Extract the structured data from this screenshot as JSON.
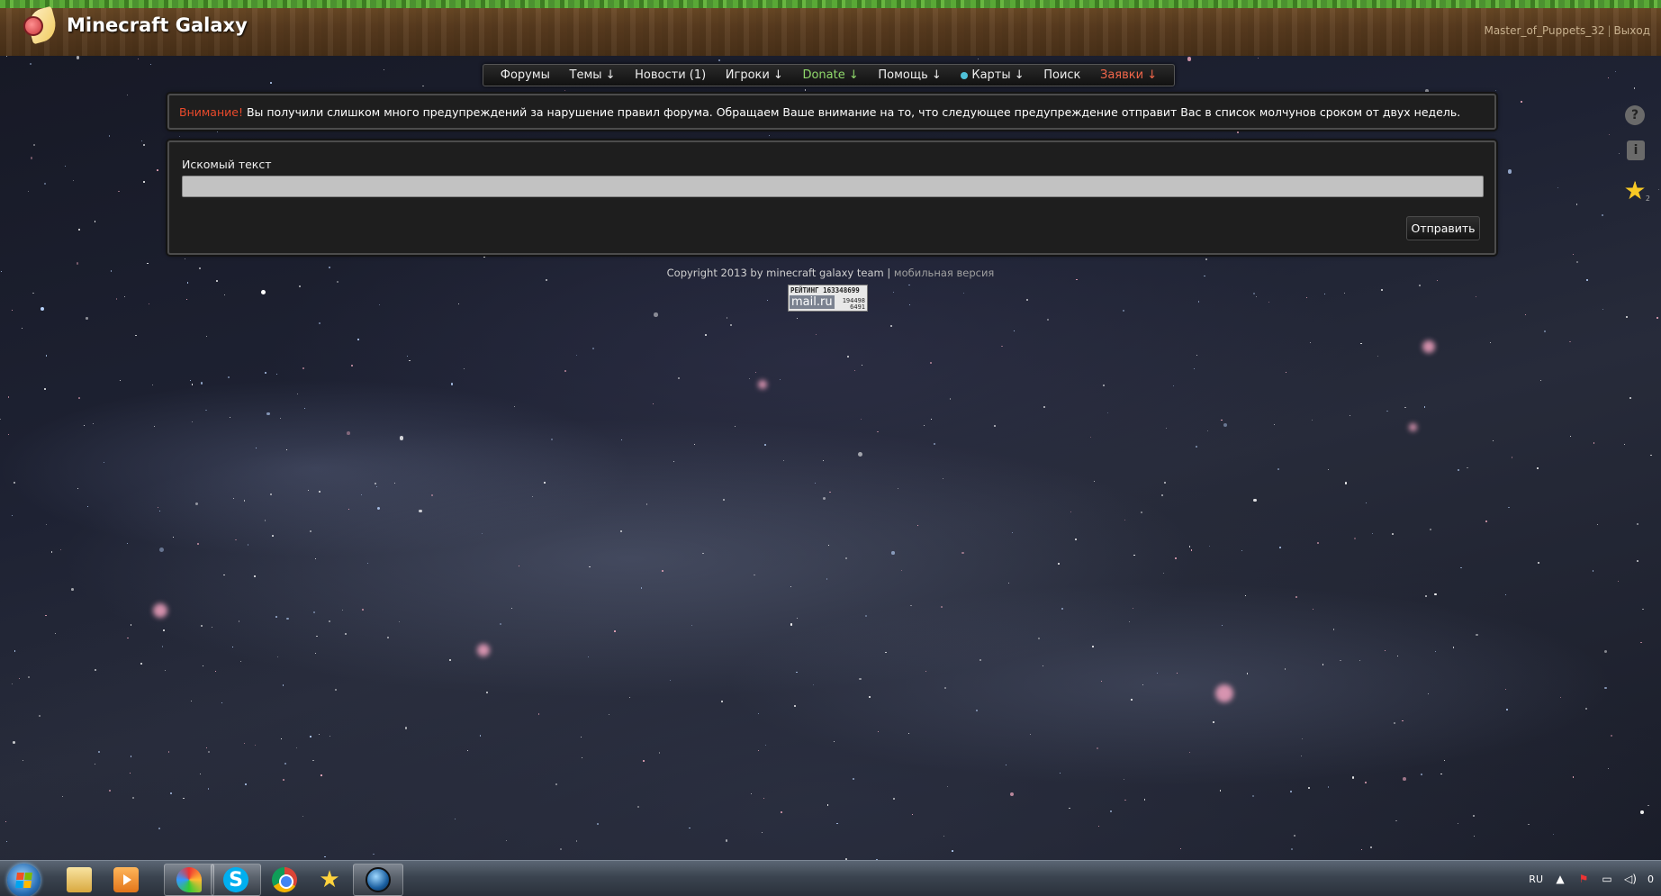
{
  "header": {
    "site_title": "Minecraft Galaxy",
    "username": "Master_of_Puppets_32",
    "separator": "|",
    "logout": "Выход"
  },
  "nav": {
    "items": [
      {
        "label": "Форумы",
        "type": "normal"
      },
      {
        "label": "Темы ↓",
        "type": "normal"
      },
      {
        "label": "Новости (1)",
        "type": "normal"
      },
      {
        "label": "Игроки ↓",
        "type": "normal"
      },
      {
        "label": "Donate ↓",
        "type": "donate"
      },
      {
        "label": "Помощь ↓",
        "type": "normal"
      },
      {
        "label": "Карты ↓",
        "type": "maps"
      },
      {
        "label": "Поиск",
        "type": "normal"
      },
      {
        "label": "Заявки ↓",
        "type": "zayavki"
      }
    ]
  },
  "alert": {
    "prefix": "Внимание!",
    "message": " Вы получили слишком много предупреждений за нарушение правил форума. Обращаем Ваше внимание на то, что следующее предупреждение отправит Вас в список молчунов сроком от двух недель."
  },
  "search": {
    "label": "Искомый текст",
    "value": "",
    "placeholder": "",
    "submit_label": "Отправить"
  },
  "footer": {
    "copyright": "Copyright 2013 by minecraft galaxy team",
    "separator": " | ",
    "mobile_link": "мобильная версия"
  },
  "counter": {
    "line1": "РЕЙТИНГ 163348699",
    "brand": "mail.ru",
    "line2": "194498",
    "line3": "6491"
  },
  "side_icons": {
    "help": "?",
    "info": "i",
    "favorites": "★",
    "favorites_count": "2"
  },
  "taskbar": {
    "apps": [
      {
        "icon": "folder-icon",
        "active": false
      },
      {
        "icon": "media-player-icon",
        "active": false
      },
      {
        "icon": "paint-icon",
        "active": true
      },
      {
        "icon": "skype-icon",
        "active": true,
        "glyph": "S"
      },
      {
        "icon": "chrome-icon",
        "active": false
      },
      {
        "icon": "star-app-icon",
        "active": false,
        "glyph": "★"
      },
      {
        "icon": "globe-icon",
        "active": true
      }
    ],
    "tray": {
      "language": "RU",
      "clock": "0"
    }
  },
  "colors": {
    "warning_red": "#ea4a2b",
    "donate_green": "#8fd86b",
    "zayavki_red": "#f0664a",
    "grass_green": "#59a836",
    "dirt_brown": "#5a3c1f"
  }
}
